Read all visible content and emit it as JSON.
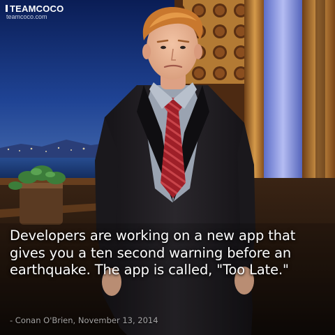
{
  "logo": {
    "brand": "TEAMCOCO",
    "url": "teamcoco.com"
  },
  "quote": {
    "text": "Developers are working on a new app that gives you a ten second warning before an earthquake. The app is called, \"Too Late.\"",
    "attribution": "- Conan O'Brien, November 13, 2014"
  },
  "colors": {
    "sky": "#1a3a86",
    "suit": "#1c1a1f",
    "tie": "#a4212a",
    "curtain": "#c98a3a",
    "text": "#ffffff"
  }
}
